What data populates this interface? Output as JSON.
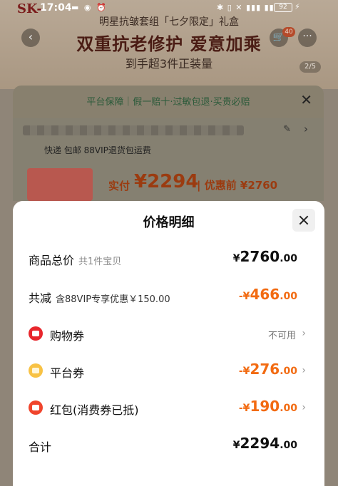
{
  "status_bar": {
    "time": "17:04",
    "battery": "92"
  },
  "background": {
    "banner": {
      "brand": "SK-",
      "line1": "明星抗皱套组「七夕限定」礼盒",
      "line2": "双重抗老修护 爱意加乘",
      "line3": "到手超3件正装量",
      "image_counter": "2/5",
      "cart_badge": "40"
    },
    "guarantee": "平台保障｜假一赔十·过敏包退·买贵必赔",
    "shipping": "快递 包邮   88VIP退货包运费",
    "actual_label": "实付",
    "actual_price": "¥2294",
    "original_label": "| 优惠前 ¥2760"
  },
  "sheet": {
    "title": "价格明细",
    "rows": {
      "total": {
        "label": "商品总价",
        "sub": "共1件宝贝",
        "currency": "¥",
        "int": "2760",
        "dec": ".00"
      },
      "reduce": {
        "label": "共减",
        "sub": "含88VIP专享优惠￥150.00",
        "currency": "-¥",
        "int": "466",
        "dec": ".00"
      },
      "shopping_coupon": {
        "label": "购物券",
        "status": "不可用"
      },
      "platform_coupon": {
        "label": "平台券",
        "currency": "-¥",
        "int": "276",
        "dec": ".00"
      },
      "red_packet": {
        "label": "红包(消费券已抵)",
        "currency": "-¥",
        "int": "190",
        "dec": ".00"
      },
      "sum": {
        "label": "合计",
        "currency": "¥",
        "int": "2294",
        "dec": ".00"
      }
    }
  },
  "colors": {
    "accent_orange": "#f26b12",
    "coupon_red": "#e8262c",
    "coupon_yellow": "#f8c244"
  }
}
